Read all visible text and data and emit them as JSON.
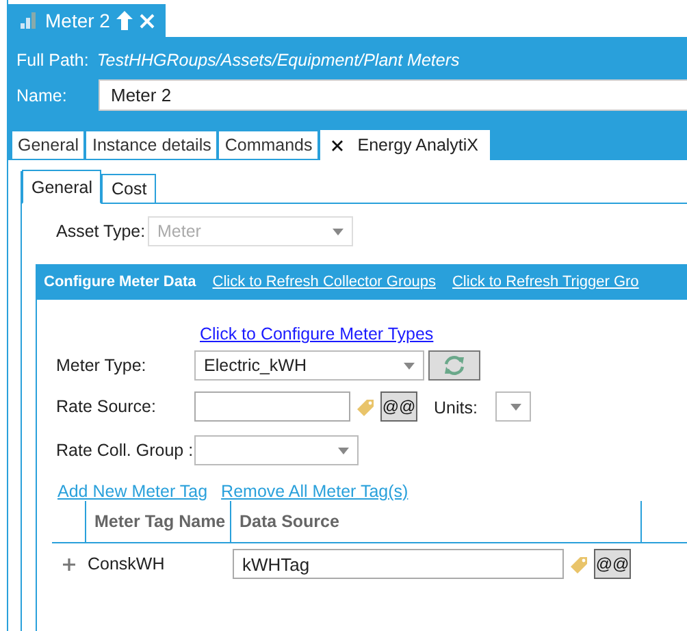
{
  "document_tab": {
    "title": "Meter 2"
  },
  "full_path": {
    "label": "Full Path:",
    "value": "TestHHGRoups/Assets/Equipment/Plant Meters"
  },
  "name": {
    "label": "Name:",
    "value": "Meter 2"
  },
  "tabs": [
    {
      "label": "General",
      "selected": false,
      "closable": false
    },
    {
      "label": "Instance details",
      "selected": false,
      "closable": false
    },
    {
      "label": "Commands",
      "selected": false,
      "closable": false
    },
    {
      "label": "Energy AnalytiX",
      "selected": true,
      "closable": true
    }
  ],
  "sub_tabs": [
    {
      "label": "General",
      "selected": true
    },
    {
      "label": "Cost",
      "selected": false
    }
  ],
  "asset_type": {
    "label": "Asset Type:",
    "value": "Meter",
    "disabled": true
  },
  "section": {
    "title": "Configure Meter Data",
    "links": [
      "Click to Refresh Collector Groups",
      "Click to Refresh Trigger Gro"
    ]
  },
  "configure_link": "Click to Configure Meter Types",
  "meter_type": {
    "label": "Meter Type:",
    "value": "Electric_kWH"
  },
  "rate_source": {
    "label": "Rate Source:",
    "picker": "@@"
  },
  "units": {
    "label": "Units:"
  },
  "rate_coll_group": {
    "label": "Rate Coll. Group :"
  },
  "tag_links": [
    "Add New Meter Tag",
    "Remove All Meter Tag(s)"
  ],
  "grid": {
    "columns": [
      "Meter Tag Name",
      "Data Source"
    ],
    "rows": [
      {
        "name": "ConskWH",
        "data_source": "kWHTag",
        "picker": "@@",
        "expanded": false
      }
    ]
  }
}
